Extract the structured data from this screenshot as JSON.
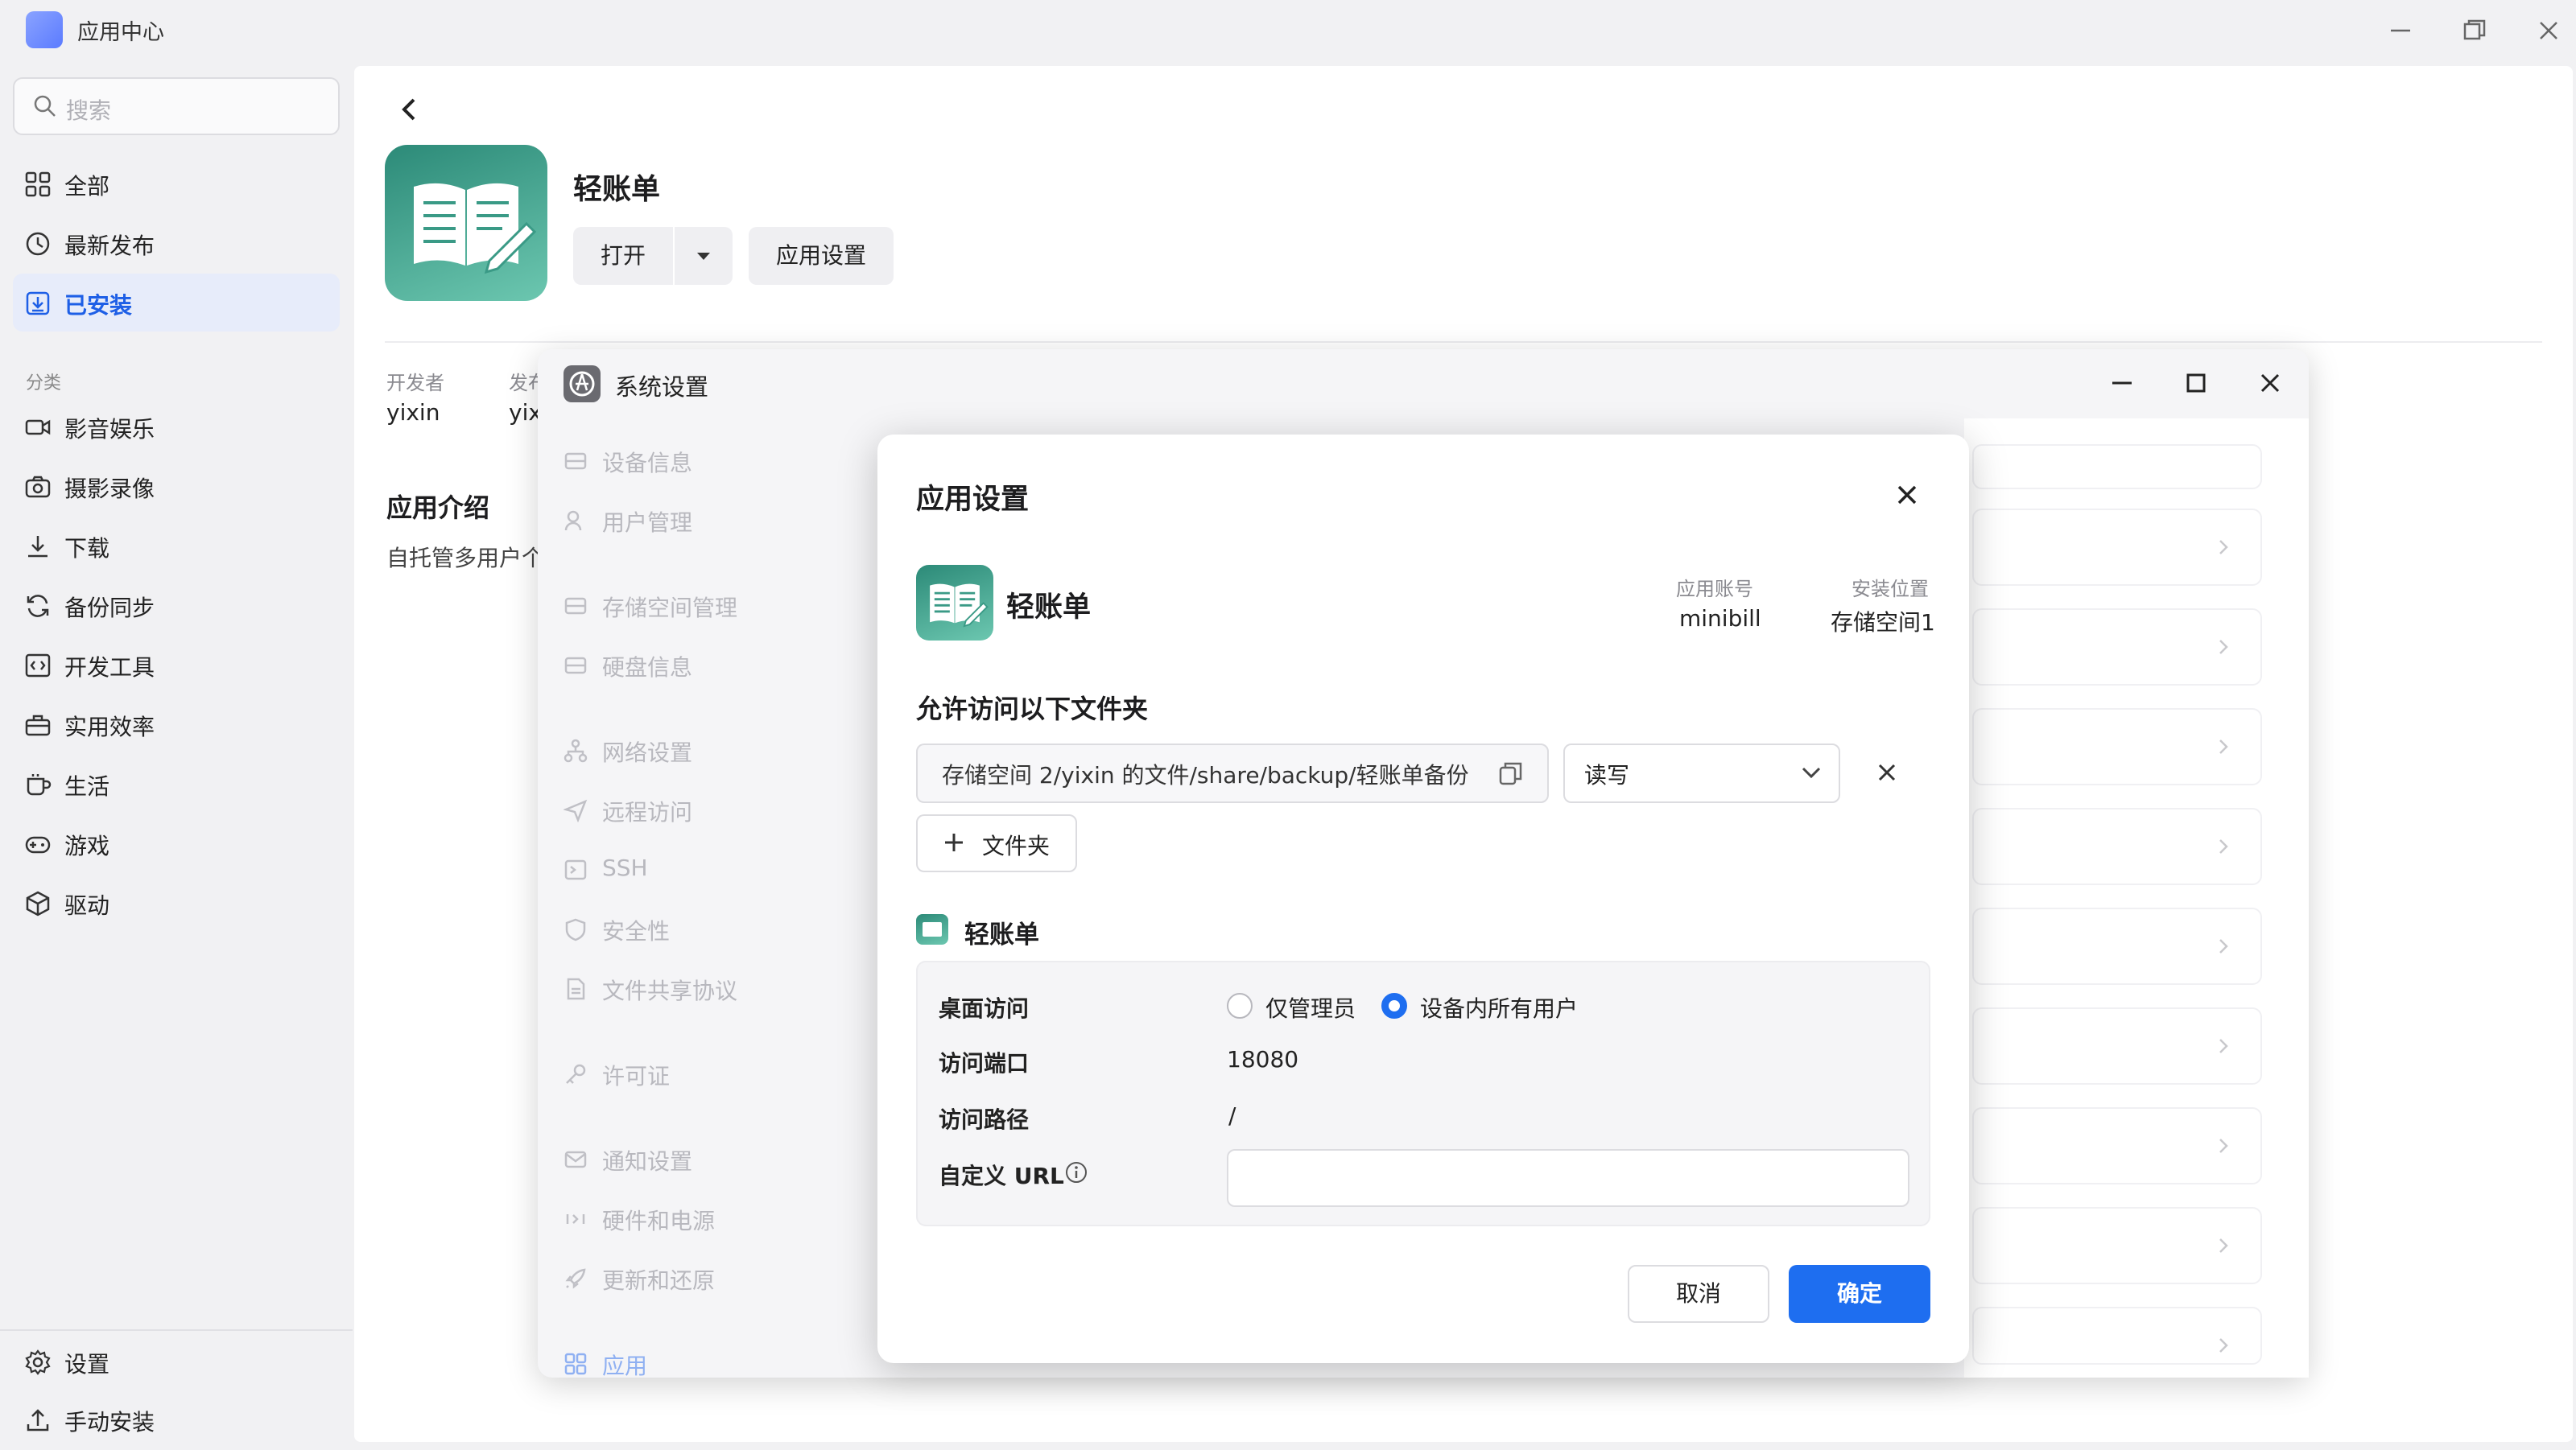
{
  "window": {
    "title": "应用中心"
  },
  "sidebar": {
    "search_placeholder": "搜索",
    "items": [
      {
        "label": "全部",
        "icon": "grid-icon"
      },
      {
        "label": "最新发布",
        "icon": "clock-icon"
      },
      {
        "label": "已安装",
        "icon": "installed-icon",
        "active": true
      }
    ],
    "category_title": "分类",
    "categories": [
      {
        "label": "影音娱乐",
        "icon": "video-icon"
      },
      {
        "label": "摄影录像",
        "icon": "camera-icon"
      },
      {
        "label": "下载",
        "icon": "download-icon"
      },
      {
        "label": "备份同步",
        "icon": "sync-icon"
      },
      {
        "label": "开发工具",
        "icon": "code-icon"
      },
      {
        "label": "实用效率",
        "icon": "toolbox-icon"
      },
      {
        "label": "生活",
        "icon": "cup-icon"
      },
      {
        "label": "游戏",
        "icon": "gamepad-icon"
      },
      {
        "label": "驱动",
        "icon": "cube-icon"
      }
    ],
    "bottom": [
      {
        "label": "设置",
        "icon": "gear-icon"
      },
      {
        "label": "手动安装",
        "icon": "upload-icon"
      }
    ]
  },
  "app_detail": {
    "name": "轻账单",
    "open_label": "打开",
    "settings_label": "应用设置",
    "developer_label": "开发者",
    "developer_value": "yixin",
    "publisher_label": "发布",
    "publisher_value": "yix",
    "intro_title": "应用介绍",
    "intro_text": "自托管多用户个"
  },
  "system_settings": {
    "title": "系统设置",
    "menu": [
      {
        "label": "设备信息",
        "icon": "device-icon"
      },
      {
        "label": "用户管理",
        "icon": "users-icon"
      },
      {
        "label": "存储空间管理",
        "icon": "storage-icon"
      },
      {
        "label": "硬盘信息",
        "icon": "disk-icon"
      },
      {
        "label": "网络设置",
        "icon": "network-icon"
      },
      {
        "label": "远程访问",
        "icon": "send-icon"
      },
      {
        "label": "SSH",
        "icon": "terminal-icon"
      },
      {
        "label": "安全性",
        "icon": "shield-icon"
      },
      {
        "label": "文件共享协议",
        "icon": "file-icon"
      },
      {
        "label": "许可证",
        "icon": "key-icon"
      },
      {
        "label": "通知设置",
        "icon": "mail-icon"
      },
      {
        "label": "硬件和电源",
        "icon": "power-icon"
      },
      {
        "label": "更新和还原",
        "icon": "rocket-icon"
      },
      {
        "label": "应用",
        "icon": "apps-icon"
      }
    ]
  },
  "dialog": {
    "title": "应用设置",
    "app_name": "轻账单",
    "account_label": "应用账号",
    "account_value": "minibill",
    "location_label": "安装位置",
    "location_value": "存储空间1",
    "folders_title": "允许访问以下文件夹",
    "folder_path": "存储空间 2/yixin 的文件/share/backup/轻账单备份",
    "folder_permission": "读写",
    "add_folder_label": "文件夹",
    "sub_app_name": "轻账单",
    "desktop_access_label": "桌面访问",
    "option_admin": "仅管理员",
    "option_all_users": "设备内所有用户",
    "selected_option": "设备内所有用户",
    "port_label": "访问端口",
    "port_value": "18080",
    "path_label": "访问路径",
    "path_value": "/",
    "custom_url_label": "自定义 URL",
    "custom_url_value": "",
    "cancel_label": "取消",
    "ok_label": "确定"
  },
  "colors": {
    "accent": "#1e6ef0",
    "active_bg": "#e7ecfa",
    "app_icon": "#3a9a86"
  }
}
